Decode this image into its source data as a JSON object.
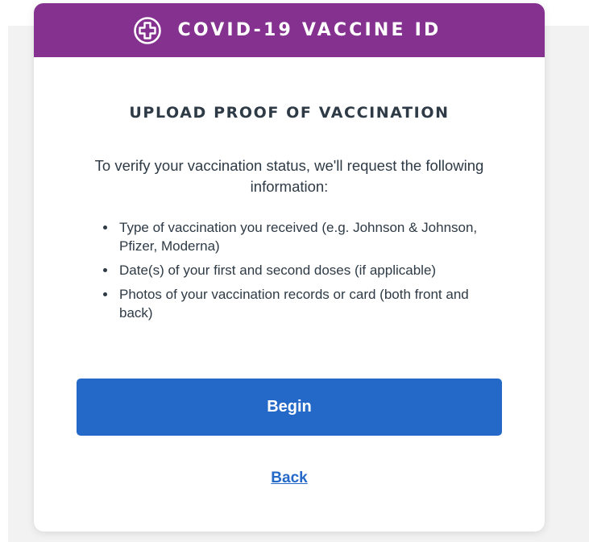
{
  "header": {
    "title": "COVID-19 VACCINE ID",
    "icon": "medical-cross-icon"
  },
  "section": {
    "title": "UPLOAD PROOF OF VACCINATION",
    "intro": "To verify your vaccination status, we'll request the following information:"
  },
  "requirements": [
    {
      "text": "Type of vaccination you received (e.g. Johnson & Johnson, Pfizer, Moderna)"
    },
    {
      "text": "Date(s) of your first and second doses (if applicable)"
    },
    {
      "text": "Photos of your vaccination records or card (both front and back)"
    }
  ],
  "actions": {
    "begin_label": "Begin",
    "back_label": "Back"
  },
  "colors": {
    "header_bg": "#85318f",
    "primary_button": "#2569c8",
    "link": "#2569c8",
    "text": "#2e3a45",
    "page_bg": "#f2f2f2"
  }
}
